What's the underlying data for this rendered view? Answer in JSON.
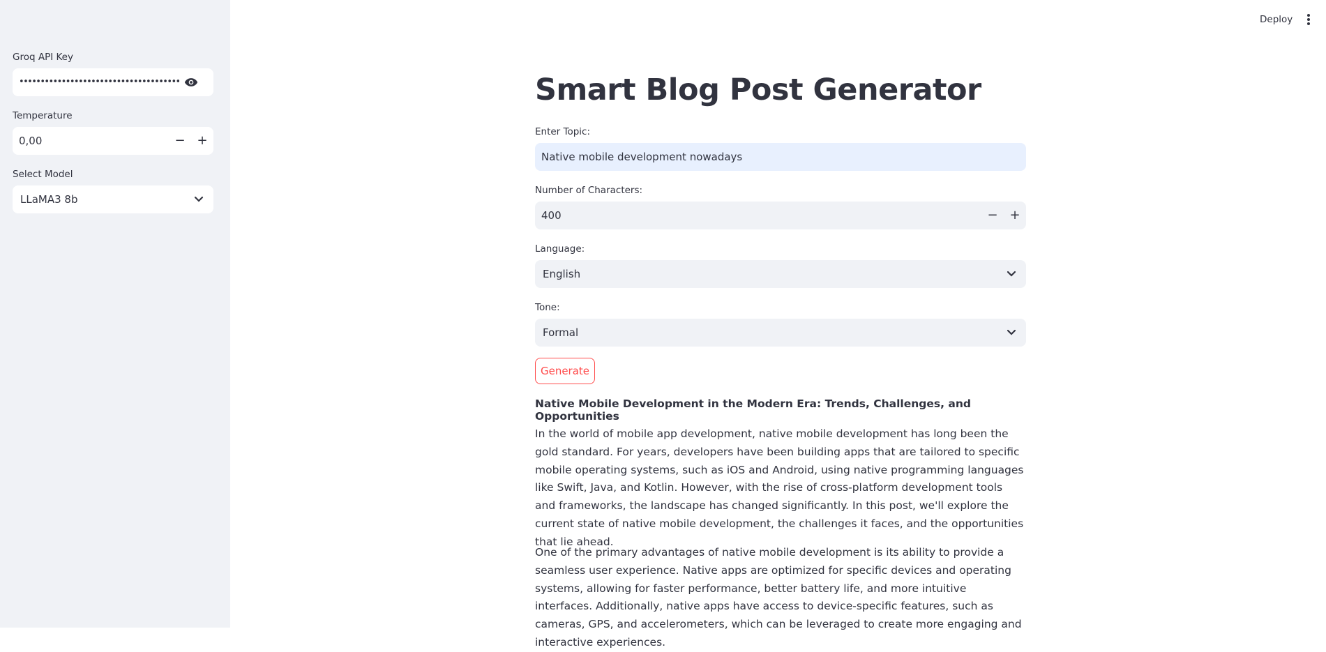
{
  "sidebar": {
    "api_key": {
      "label": "Groq API Key",
      "value": "••••••••••••••••••••••••••••••••••••••••••••••••••••••"
    },
    "temperature": {
      "label": "Temperature",
      "value": "0,00",
      "minus": "−",
      "plus": "+"
    },
    "model": {
      "label": "Select Model",
      "value": "LLaMA3 8b"
    }
  },
  "header": {
    "deploy_label": "Deploy"
  },
  "main": {
    "title": "Smart Blog Post Generator",
    "topic": {
      "label": "Enter Topic:",
      "value": "Native mobile development nowadays"
    },
    "chars": {
      "label": "Number of Characters:",
      "value": "400",
      "minus": "−",
      "plus": "+"
    },
    "language": {
      "label": "Language:",
      "value": "English"
    },
    "tone": {
      "label": "Tone:",
      "value": "Formal"
    },
    "generate_label": "Generate",
    "post": {
      "title": "Native Mobile Development in the Modern Era: Trends, Challenges, and Opportunities",
      "paragraphs": [
        "In the world of mobile app development, native mobile development has long been the gold standard. For years, developers have been building apps that are tailored to specific mobile operating systems, such as iOS and Android, using native programming languages like Swift, Java, and Kotlin. However, with the rise of cross-platform development tools and frameworks, the landscape has changed significantly. In this post, we'll explore the current state of native mobile development, the challenges it faces, and the opportunities that lie ahead.",
        "One of the primary advantages of native mobile development is its ability to provide a seamless user experience. Native apps are optimized for specific devices and operating systems, allowing for faster performance, better battery life, and more intuitive interfaces. Additionally, native apps have access to device-specific features, such as cameras, GPS, and accelerometers, which can be leveraged to create more engaging and interactive experiences."
      ]
    }
  },
  "colors": {
    "accent": "#ff4b4b",
    "sidebar_bg": "#f0f2f6",
    "text": "#31333f"
  },
  "icons": [
    "eye-icon",
    "chevron-down-icon",
    "kebab-menu-icon",
    "minus-icon",
    "plus-icon"
  ]
}
